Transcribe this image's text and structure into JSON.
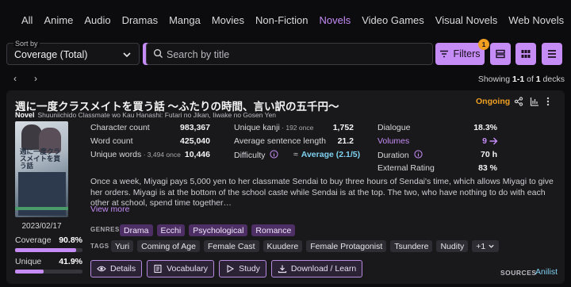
{
  "categories": [
    "All",
    "Anime",
    "Audio",
    "Dramas",
    "Manga",
    "Movies",
    "Non-Fiction",
    "Novels",
    "Video Games",
    "Visual Novels",
    "Web Novels"
  ],
  "active_category": "Novels",
  "sort": {
    "label": "Sort by",
    "value": "Coverage (Total)"
  },
  "search": {
    "placeholder": "Search by title"
  },
  "filters": {
    "label": "Filters",
    "count": "1"
  },
  "pager": {
    "prev": "‹",
    "next": "›",
    "showing_prefix": "Showing ",
    "range": "1-1",
    "of": " of ",
    "total": "1",
    "suffix": " decks"
  },
  "deck": {
    "title": "週に一度クラスメイトを買う話 〜ふたりの時間、言い訳の五千円〜",
    "type": "Novel",
    "romaji": "Shuuniichido Classmate wo Kau Hanashi: Futari no Jikan, Iiwake no Gosen Yen",
    "status": "Ongoing",
    "cover_title": "週に一度クラスメイトを買う話",
    "date": "2023/02/17",
    "coverage_label": "Coverage",
    "coverage_value": "90.8%",
    "coverage_fraction": 0.908,
    "unique_label": "Unique",
    "unique_value": "41.9%",
    "unique_fraction": 0.419,
    "stats_col1": [
      {
        "label": "Character count",
        "note": "",
        "value": "983,367"
      },
      {
        "label": "Word count",
        "note": "",
        "value": "425,040"
      },
      {
        "label": "Unique words",
        "note": " · 3,494 once",
        "value": "10,446"
      }
    ],
    "stats_col2": [
      {
        "label": "Unique kanji",
        "note": " · 192 once",
        "value": "1,752"
      },
      {
        "label": "Average sentence length",
        "note": "",
        "value": "21.2"
      },
      {
        "label": "Difficulty",
        "note": "",
        "value": "Average (2.1/5)",
        "approx": "≈"
      }
    ],
    "stats_col3": [
      {
        "label": "Dialogue",
        "value": "18.3%"
      },
      {
        "label": "Volumes",
        "value": "9"
      },
      {
        "label": "Duration",
        "value": "70 h"
      },
      {
        "label": "External Rating",
        "value": "83 %"
      }
    ],
    "description": "Once a week, Miyagi pays 5,000 yen to her classmate Sendai to buy three hours of Sendai's time, which allows Miyagi to give her orders. Miyagi is at the bottom of the school caste while Sendai is at the top. The two, who have nothing to do with each other at school, spend time together…",
    "more": "View more",
    "genres_label": "GENRES",
    "genres": [
      "Drama",
      "Ecchi",
      "Psychological",
      "Romance"
    ],
    "tags_label": "TAGS",
    "tags": [
      "Yuri",
      "Coming of Age",
      "Female Cast",
      "Kuudere",
      "Female Protagonist",
      "Tsundere",
      "Nudity",
      "+1"
    ],
    "actions": [
      "Details",
      "Vocabulary",
      "Study",
      "Download / Learn"
    ],
    "sources_label": "SOURCES",
    "source": "Anilist"
  },
  "colors": {
    "accent": "#c58cf5",
    "status": "#f0a020",
    "link": "#7fd0f0",
    "badge": "#f0a020"
  }
}
